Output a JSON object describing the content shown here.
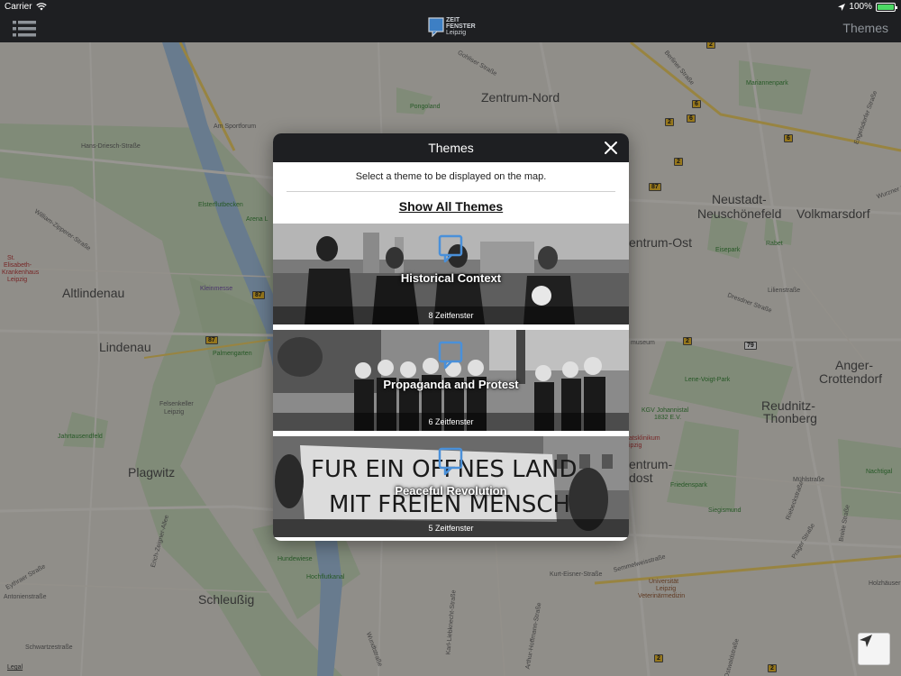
{
  "status_bar": {
    "carrier": "Carrier",
    "time": "",
    "battery": "100%",
    "battery_level": 100
  },
  "nav": {
    "logo_line1": "ZEIT",
    "logo_line2": "FENSTER",
    "logo_line3": "Leipzig",
    "right_label": "Themes"
  },
  "map": {
    "districts": {
      "zentrum_nord": "Zentrum-Nord",
      "altlindenau": "Altlindenau",
      "lindenau": "Lindenau",
      "plagwitz": "Plagwitz",
      "schleussig": "Schleußig",
      "neustadt_1": "Neustadt-",
      "neustadt_2": "Neuschönefeld",
      "volkmarsdorf": "Volkmarsdorf",
      "zentrum_ost": "entrum-Ost",
      "anger_1": "Anger-",
      "anger_2": "Crottendorf",
      "reudnitz_1": "Reudnitz-",
      "reudnitz_2": "Thonberg",
      "zentrum_sudost": "entrum-",
      "zentrum_sudost_2": "dost"
    },
    "pois": {
      "pongoland": "Pongoland",
      "elsterflutbecken": "Elsterflutbecken",
      "arena": "Arena L",
      "kleinmesse": "Kleinmesse",
      "palmengarten": "Palmengarten",
      "jahrtausendfeld": "Jahrtausendfeld",
      "felsenkeller_1": "Felsenkeller",
      "felsenkeller_2": "Leipzig",
      "hundewiese": "Hundewiese",
      "hochflutkanal": "Hochflutkanal",
      "mariannenpark": "Mariannenpark",
      "eisepark": "Eisepark",
      "rabet": "Rabet",
      "lene_voigt": "Lene-Voigt-Park",
      "museum": "museum",
      "kgv_1": "KGV Johannistal",
      "kgv_2": "1832 E.V.",
      "friedenspark": "Friedenspark",
      "siegismund": "Siegismund",
      "nachtigal": "Nachtigal",
      "uni_1": "Universität",
      "uni_2": "Leipzig",
      "uni_3": "Veterinärmedizin",
      "krankenhaus_1": "St.",
      "krankenhaus_2": "Elisabeth-",
      "krankenhaus_3": "Krankenhaus",
      "krankenhaus_4": "Leipzig",
      "klinikum": "atsklinikum",
      "klinikum_2": "ipzig"
    },
    "streets": {
      "am_sportforum": "Am Sportforum",
      "hans_driesch": "Hans-Driesch-Straße",
      "william_zipperer": "William-Zipperer-Straße",
      "gohliser": "Gohliser Straße",
      "kurt_eisner": "Kurt-Eisner-Straße",
      "semmelweis": "Semmelweisstraße",
      "dresdner": "Dresdner Straße",
      "lilienstrasse": "Lilienstraße",
      "riebeck": "Riebeckstraße",
      "holzhausener": "Holzhäuser",
      "erich_zeigner": "Erich-Zeigner-Allee",
      "antonienstrasse": "Antonienstraße",
      "schwartzestrasse": "Schwartzestraße",
      "eythraer": "Eythraer Straße",
      "berliner": "Berliner Straße",
      "wurzner": "Wurzner Straße",
      "prager": "Prager Straße",
      "arthur_hoffmann": "Arthur-Hoffmann-Straße",
      "karl_liebknecht": "Karl-Liebknecht-Straße",
      "wundtstrasse": "Wundtstraße",
      "ostwaldstrasse": "Ostwaldstraße",
      "engelsdorfer": "Engelsdorfer Straße",
      "breite_strasse": "Breite Straße",
      "muhlstrasse": "Mühlstraße"
    },
    "routes": {
      "r2": "2",
      "r6": "6",
      "r87": "87",
      "r79": "79"
    },
    "legal": "Legal"
  },
  "modal": {
    "title": "Themes",
    "description": "Select a theme to be displayed on the map.",
    "show_all": "Show All Themes",
    "themes": [
      {
        "name": "Historical Context",
        "count": "8 Zeitfenster"
      },
      {
        "name": "Propaganda and Protest",
        "count": "6 Zeitfenster"
      },
      {
        "name": "Peaceful Revolution",
        "count": "5 Zeitfenster"
      }
    ],
    "banner_line1": "FUR EIN OFFNES LAND",
    "banner_line2": "MIT FREIEN MENSCHEN"
  },
  "colors": {
    "bar_bg": "#1e1f22",
    "accent": "#4a90d9",
    "battery": "#4cd964",
    "route_badge": "#f2c12e"
  },
  "icons": {
    "menu": "list-menu-icon",
    "wifi": "wifi-icon",
    "location": "location-arrow-icon",
    "battery": "battery-icon",
    "close": "close-icon",
    "theme": "speech-bubble-icon",
    "locate": "navigation-arrow-icon"
  }
}
